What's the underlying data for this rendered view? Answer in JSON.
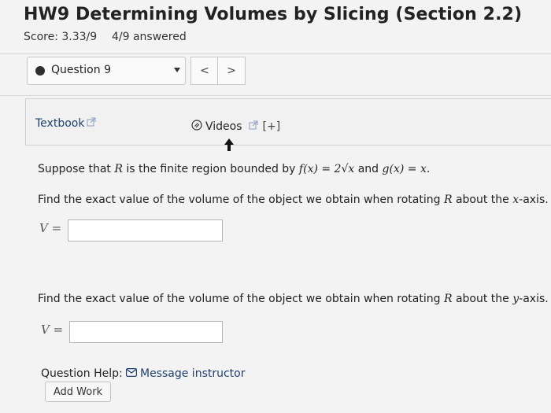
{
  "header": {
    "title": "HW9 Determining Volumes by Slicing (Section 2.2)",
    "score": "Score: 3.33/9",
    "answered": "4/9 answered"
  },
  "question_nav": {
    "selected": "Question 9",
    "prev_label": "<",
    "next_label": ">"
  },
  "resources": {
    "textbook": "Textbook",
    "videos": "Videos",
    "expand": "[+]"
  },
  "problem": {
    "s1_a": "Suppose that ",
    "s1_R": "R",
    "s1_b": " is the finite region bounded by ",
    "s1_f": "f(x) = 2√x",
    "s1_c": " and ",
    "s1_g": "g(x) = x",
    "s1_d": ".",
    "s2_a": "Find the exact value of the volume of the object we obtain when rotating ",
    "s2_R": "R",
    "s2_b": " about the ",
    "s2_axis": "x",
    "s2_c": "-axis.",
    "s3_a": "Find the exact value of the volume of the object we obtain when rotating ",
    "s3_R": "R",
    "s3_b": " about the ",
    "s3_axis": "y",
    "s3_c": "-axis.",
    "answer_label_1": "V =",
    "answer_label_2": "V =",
    "answer_value_1": "",
    "answer_value_2": ""
  },
  "help": {
    "label": "Question Help:",
    "message": "Message instructor",
    "add_work": "Add Work"
  },
  "colors": {
    "link": "#1f3f6e",
    "background": "#f3f3f4"
  },
  "icons": [
    "external-link-icon",
    "paperclip-icon",
    "mail-icon",
    "dropdown-caret-icon",
    "mouse-cursor-icon"
  ]
}
